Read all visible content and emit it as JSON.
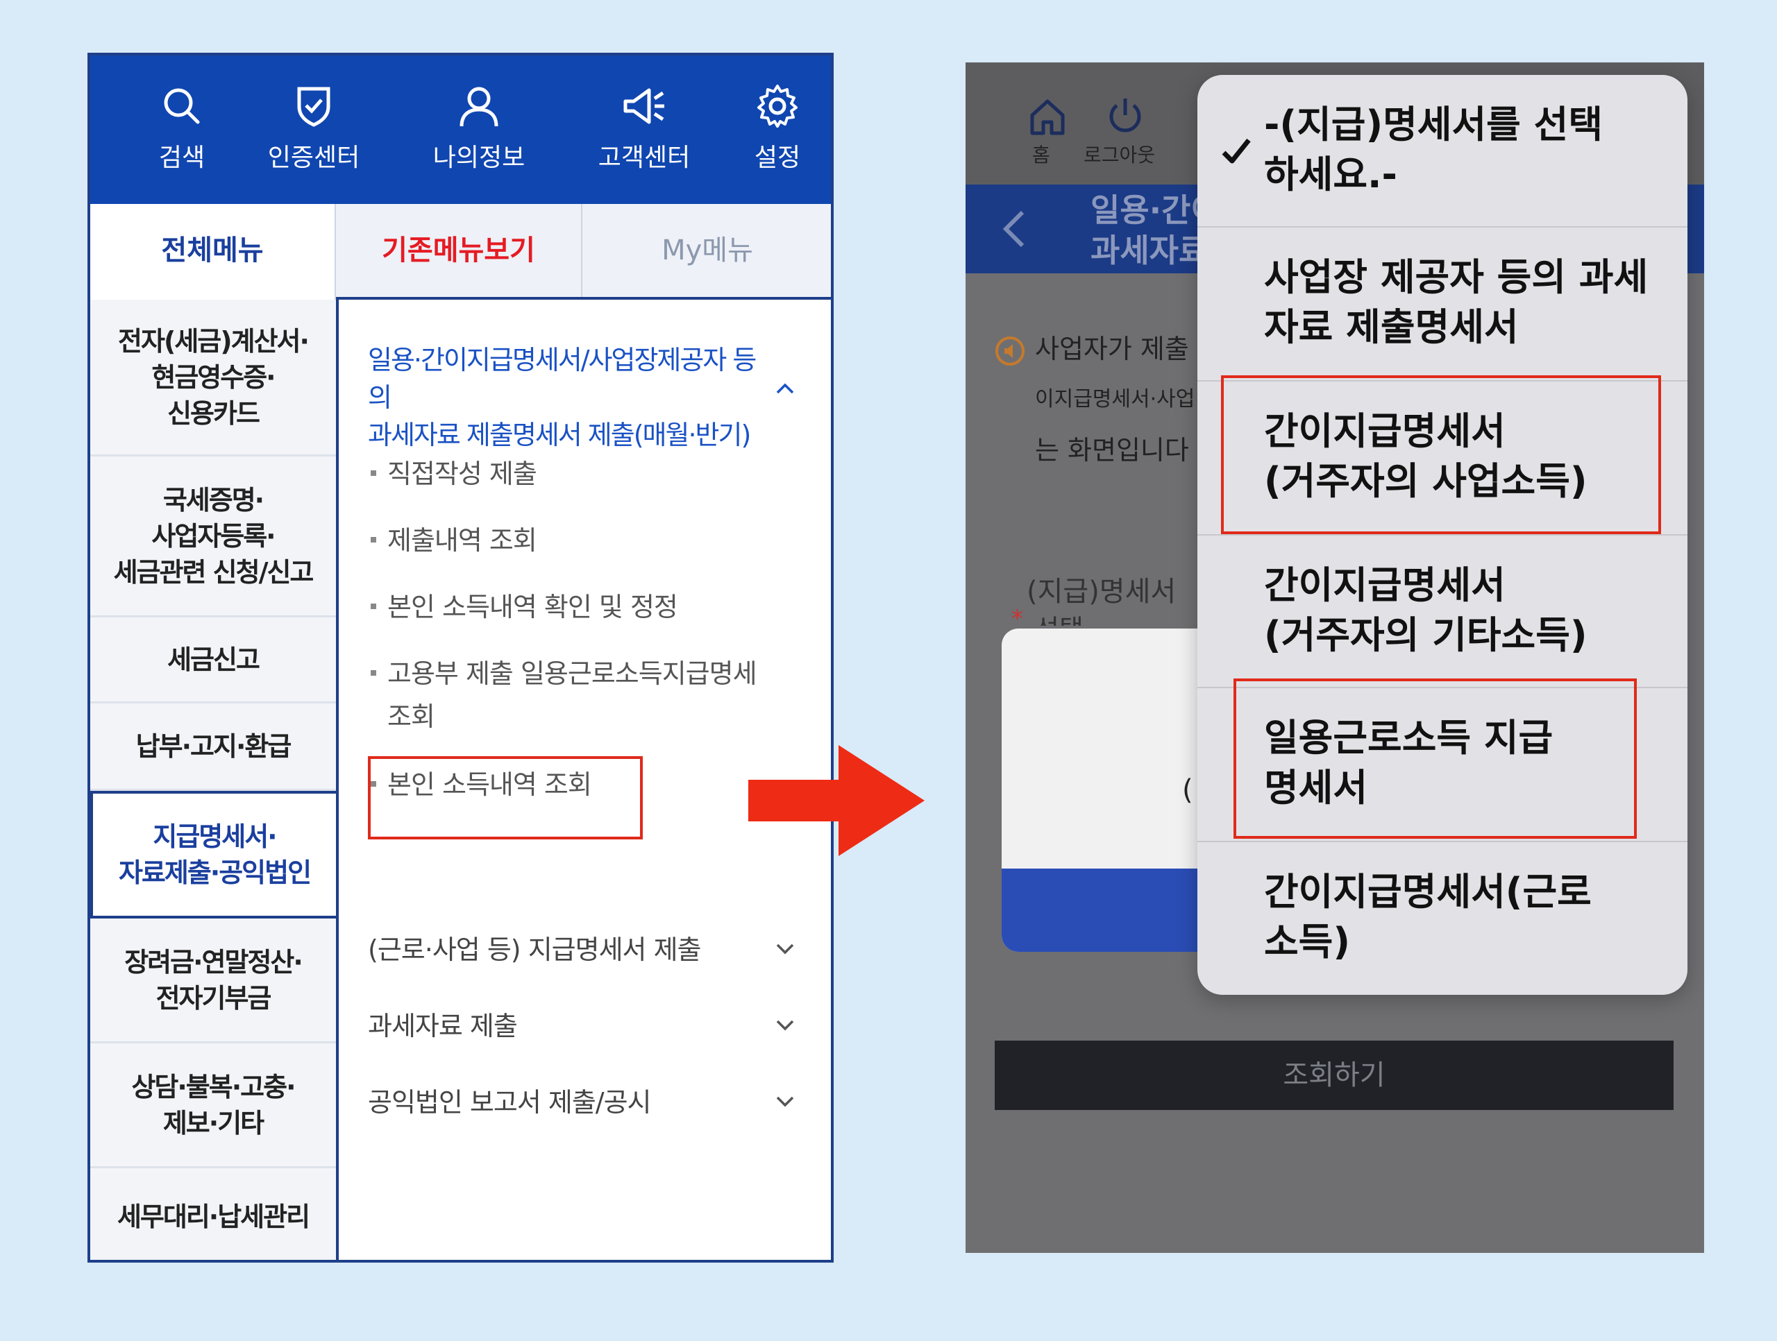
{
  "left": {
    "topbar": [
      {
        "icon": "search-icon",
        "label": "검색"
      },
      {
        "icon": "shield-check-icon",
        "label": "인증센터"
      },
      {
        "icon": "person-icon",
        "label": "나의정보"
      },
      {
        "icon": "megaphone-icon",
        "label": "고객센터"
      },
      {
        "icon": "gear-icon",
        "label": "설정"
      }
    ],
    "tabs": {
      "all": "전체메뉴",
      "basic": "기존메뉴보기",
      "my": "My메뉴"
    },
    "sidebar": [
      {
        "line1": "전자(세금)계산서·",
        "line2": "현금영수증·",
        "line3": "신용카드"
      },
      {
        "line1": "국세증명·",
        "line2": "사업자등록·",
        "line3": "세금관련 신청/신고"
      },
      {
        "line1": "세금신고"
      },
      {
        "line1": "납부·고지·환급"
      },
      {
        "line1": "지급명세서·",
        "line2": "자료제출·공익법인"
      },
      {
        "line1": "장려금·연말정산·",
        "line2": "전자기부금"
      },
      {
        "line1": "상담·불복·고충·",
        "line2": "제보·기타"
      },
      {
        "line1": "세무대리·납세관리"
      }
    ],
    "section": {
      "title_line1": "일용·간이지급명세서/사업장제공자 등의",
      "title_line2": "과세자료 제출명세서 제출(매월·반기)",
      "items": [
        "직접작성 제출",
        "제출내역 조회",
        "본인 소득내역 확인 및 정정",
        "고용부 제출 일용근로소득지급명세",
        "조회",
        "본인 소득내역 조회"
      ]
    },
    "categories": [
      "(근로·사업 등) 지급명세서 제출",
      "과세자료 제출",
      "공익법인 보고서 제출/공시"
    ]
  },
  "right": {
    "home_label": "홈",
    "logout_label": "로그아웃",
    "header_line1": "일용·간이",
    "header_line2": "과세자료",
    "notice": "사업자가 제출",
    "sub1": "이지급명세서·사업",
    "sub2": "는 화면입니다",
    "field_label": "(지급)명세서",
    "field_label2": "선택",
    "star": "*",
    "card_paren": "(",
    "query_button": "조회하기",
    "dropdown": [
      {
        "line1": "-(지급)명세서를 선택",
        "line2": "하세요.-",
        "checked": true
      },
      {
        "line1": "사업장 제공자 등의 과세",
        "line2": "자료 제출명세서"
      },
      {
        "line1": "간이지급명세서",
        "line2": "(거주자의 사업소득)"
      },
      {
        "line1": "간이지급명세서",
        "line2": "(거주자의 기타소득)"
      },
      {
        "line1": "일용근로소득 지급",
        "line2": "명세서"
      },
      {
        "line1": "간이지급명세서(근로",
        "line2": "소득)"
      }
    ]
  },
  "colors": {
    "brand_blue": "#1046b0",
    "highlight_red": "#e02a1a",
    "arrow_red": "#ee2b14"
  }
}
